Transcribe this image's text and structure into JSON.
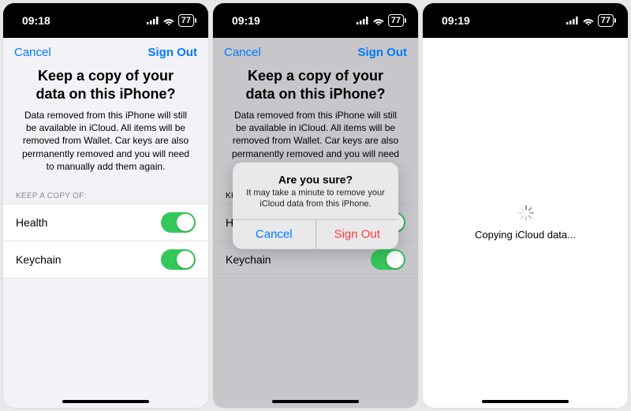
{
  "screens": [
    {
      "status": {
        "time": "09:18",
        "battery": "77"
      },
      "nav": {
        "cancel": "Cancel",
        "signout": "Sign Out"
      },
      "title": "Keep a copy of your data on this iPhone?",
      "description": "Data removed from this iPhone will still be available in iCloud. All items will be removed from Wallet. Car keys are also permanently removed and you will need to manually add them again.",
      "section_label": "KEEP A COPY OF:",
      "rows": [
        {
          "label": "Health",
          "on": true
        },
        {
          "label": "Keychain",
          "on": true
        }
      ]
    },
    {
      "status": {
        "time": "09:19",
        "battery": "77"
      },
      "nav": {
        "cancel": "Cancel",
        "signout": "Sign Out"
      },
      "title": "Keep a copy of your data on this iPhone?",
      "description": "Data removed from this iPhone will still be available in iCloud. All items will be removed from Wallet. Car keys are also permanently removed and you will need to manually add them again.",
      "section_label": "KEEP A COPY OF:",
      "rows": [
        {
          "label": "Health",
          "on": true
        },
        {
          "label": "Keychain",
          "on": true
        }
      ],
      "alert": {
        "title": "Are you sure?",
        "message": "It may take a minute to remove your iCloud data from this iPhone.",
        "cancel": "Cancel",
        "confirm": "Sign Out"
      }
    },
    {
      "status": {
        "time": "09:19",
        "battery": "77"
      },
      "loading_text": "Copying iCloud data..."
    }
  ]
}
